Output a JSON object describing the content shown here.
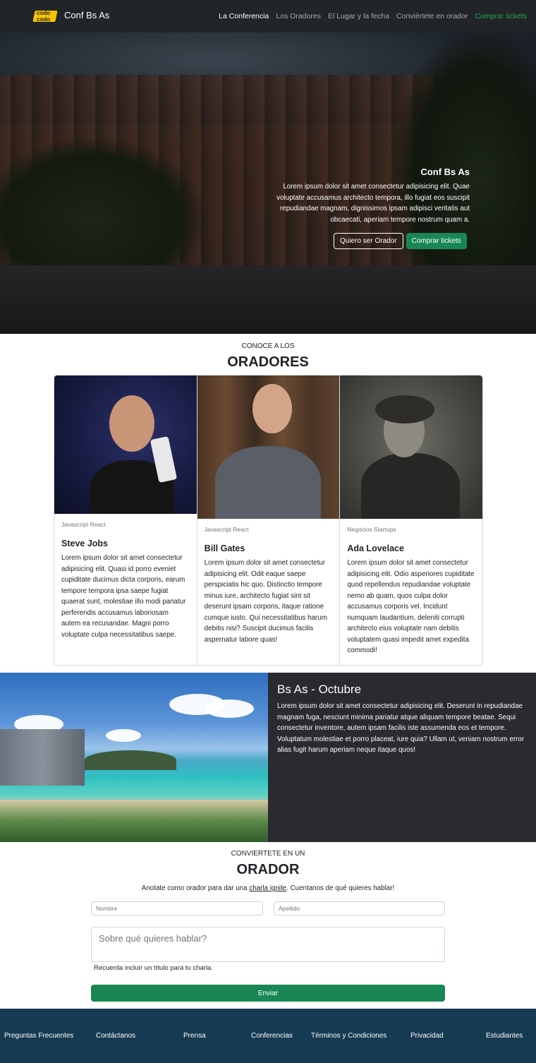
{
  "nav": {
    "logo_line1": "codo",
    "logo_line2": "codo",
    "brand": "Conf Bs As",
    "links": [
      "La Conferencia",
      "Los Oradores",
      "El Lugar y la fecha",
      "Conviértete en orador",
      "Comprar tickets"
    ]
  },
  "hero": {
    "title": "Conf Bs As",
    "text": "Lorem ipsum dolor sit amet consectetur adipisicing elit. Quae voluptate accusamus architecto tempora, illo fugiat eos suscipit repudiandae magnam, dignissimos ipsam adipisci veritatis aut obcaecati, aperiam tempore nostrum quam a.",
    "btn_speaker": "Quiero ser Orador",
    "btn_tickets": "Comprar tickets"
  },
  "speakers": {
    "kicker": "CONOCE A LOS",
    "title": "ORADORES",
    "cards": [
      {
        "tags": "Javascript React",
        "name": "Steve Jobs",
        "text": "Lorem ipsum dolor sit amet consectetur adipisicing elit. Quasi id porro eveniet cupiditate ducimus dicta corporis, earum tempore tempora ipsa saepe fugiat quaerat sunt, molestiae illo modi pariatur perferendis accusamus laboriosam autem ea recusandae. Magni porro voluptate culpa necessitatibus saepe."
      },
      {
        "tags": "Javascript React",
        "name": "Bill Gates",
        "text": "Lorem ipsum dolor sit amet consectetur adipisicing elit. Odit eaque saepe perspiciatis hic quo. Distinctio tempore minus iure, architecto fugiat sint sit deserunt ipsam corporis, itaque ratione cumque iusto. Qui necessitatibus harum debitis nisi? Suscipit ducimus facilis aspernatur labore quas!"
      },
      {
        "tags": "Negocios Startups",
        "name": "Ada Lovelace",
        "text": "Lorem ipsum dolor sit amet consectetur adipisicing elit. Odio asperiores cupiditate quod repellendus repudiandae voluptate nemo ab quam, quos culpa dolor accusamus corporis vel. Incidunt numquam laudantium, deleniti corrupti architecto eius voluptate nam debitis voluptatem quasi impedit amet expedita commodi!"
      }
    ]
  },
  "venue": {
    "title": "Bs As - Octubre",
    "text": "Lorem ipsum dolor sit amet consectetur adipisicing elit. Deserunt in repudiandae magnam fuga, nesciunt minima pariatur atque aliquam tempore beatae. Sequi consectetur inventore, autem ipsam facilis iste assumenda eos et tempore. Voluptatum molestiae et porro placeat, iure quia? Ullam ut, veniam nostrum error alias fugit harum aperiam neque itaque quos!"
  },
  "form": {
    "kicker": "CONVIERTETE EN UN",
    "title": "ORADOR",
    "sub_before": "Anotate como orador para dar una ",
    "sub_link": "charla ignite",
    "sub_after": ". Cuentanos de qué quieres hablar!",
    "first_name_placeholder": "Nombre",
    "last_name_placeholder": "Apellido",
    "topic_placeholder": "Sobre qué quieres hablar?",
    "hint": "Recuerda incluír un título para tu charla.",
    "submit": "Enviar"
  },
  "footer": {
    "links": [
      "Preguntas Frecuentes",
      "Contáctanos",
      "Prensa",
      "Conferencias",
      "Términos y Condiciones",
      "Privacidad",
      "Estudiantes"
    ]
  }
}
